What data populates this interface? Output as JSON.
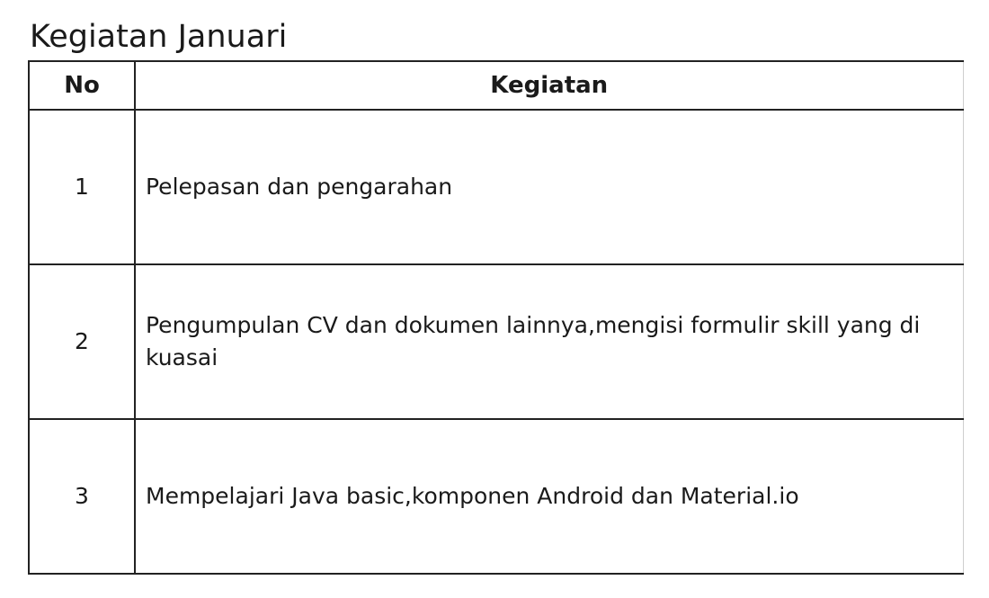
{
  "title": "Kegiatan Januari",
  "table": {
    "headers": [
      "No",
      "Kegiatan"
    ],
    "rows": [
      {
        "no": "1",
        "kegiatan": "Pelepasan dan pengarahan"
      },
      {
        "no": "2",
        "kegiatan": "Pengumpulan CV dan dokumen lainnya,mengisi formulir skill yang di kuasai"
      },
      {
        "no": "3",
        "kegiatan": "Mempelajari Java basic,komponen Android dan Material.io"
      }
    ]
  }
}
